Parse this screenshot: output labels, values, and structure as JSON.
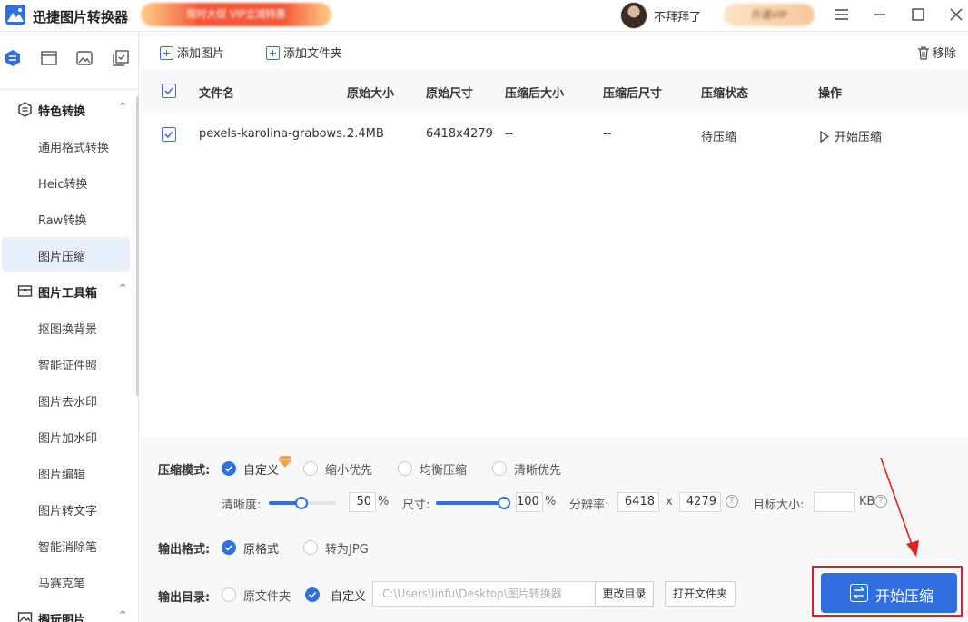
{
  "app": {
    "title": "迅捷图片转换器",
    "promo_text": "限时大促 VIP立减特惠",
    "username": "不拜拜了",
    "vip_label": "开通VIP"
  },
  "toolbar": {
    "add_image": "添加图片",
    "add_folder": "添加文件夹",
    "remove": "移除"
  },
  "sidebar": {
    "sections": [
      {
        "label": "特色转换",
        "items": [
          "通用格式转换",
          "Heic转换",
          "Raw转换",
          "图片压缩"
        ]
      },
      {
        "label": "图片工具箱",
        "items": [
          "抠图换背景",
          "智能证件照",
          "图片去水印",
          "图片加水印",
          "图片编辑",
          "图片转文字",
          "智能消除笔",
          "马赛克笔"
        ]
      },
      {
        "label": "搁玩图片"
      }
    ],
    "active_item": "图片压缩"
  },
  "table": {
    "headers": [
      "文件名",
      "原始大小",
      "原始尺寸",
      "压缩后大小",
      "压缩后尺寸",
      "压缩状态",
      "操作"
    ],
    "rows": [
      {
        "filename": "pexels-karolina-grabows...",
        "orig_size": "2.4MB",
        "orig_dim": "6418x4279",
        "new_size": "--",
        "new_dim": "--",
        "status": "待压缩",
        "action": "开始压缩",
        "checked": true
      }
    ]
  },
  "settings": {
    "mode_label": "压缩模式:",
    "modes": [
      "自定义",
      "缩小优先",
      "均衡压缩",
      "清晰优先"
    ],
    "mode_selected": "自定义",
    "clarity_label": "清晰度:",
    "clarity_value": "50",
    "clarity_level": 0.5,
    "percent": "%",
    "size_label": "尺寸:",
    "size_value": "100",
    "size_level": 1.0,
    "resolution_label": "分辨率:",
    "res_w": "6418",
    "res_x": "x",
    "res_h": "4279",
    "target_label": "目标大小:",
    "target_unit": "KB",
    "help": "?",
    "format_label": "输出格式:",
    "formats": [
      "原格式",
      "转为JPG"
    ],
    "format_selected": "原格式",
    "dir_label": "输出目录:",
    "dirs": [
      "原文件夹",
      "自定义"
    ],
    "dir_selected": "自定义",
    "dir_path": "C:\\Users\\linfu\\Desktop\\图片转换器",
    "change_dir": "更改目录",
    "open_folder": "打开文件夹",
    "start": "开始压缩"
  }
}
